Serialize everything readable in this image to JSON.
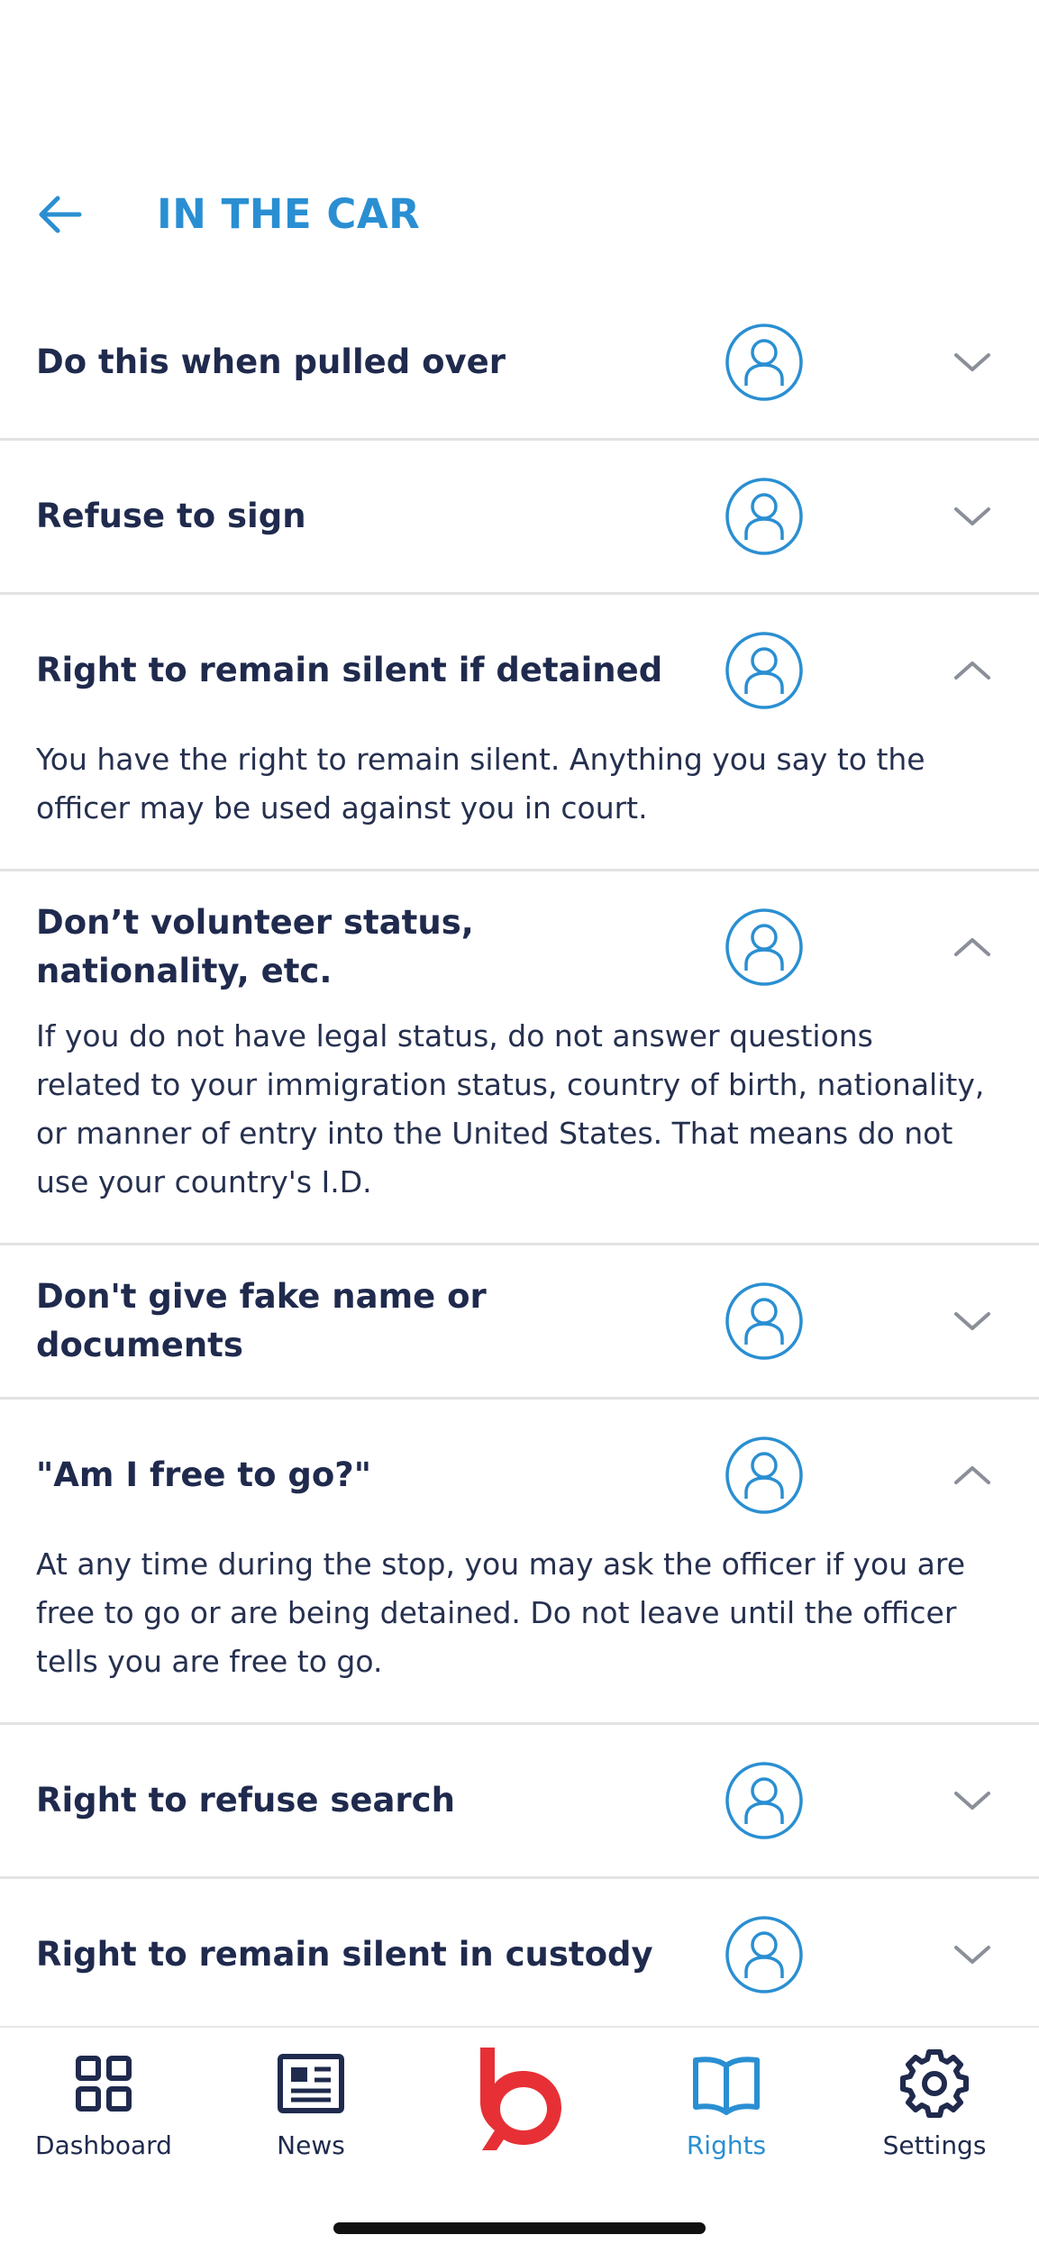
{
  "header": {
    "title": "IN THE CAR"
  },
  "items": [
    {
      "title": "Do this when pulled over",
      "expanded": false,
      "body": ""
    },
    {
      "title": "Refuse to sign",
      "expanded": false,
      "body": ""
    },
    {
      "title": "Right to remain silent if detained",
      "expanded": true,
      "body": "You have the right to remain silent. Anything you say to the officer may be used against you in court."
    },
    {
      "title": "Don’t volunteer status, nationality, etc.",
      "expanded": true,
      "body": "If you do not have legal status, do not answer questions related to your immigration status, country of birth, nationality, or manner of entry into the United States. That means do not use your country's I.D."
    },
    {
      "title": "Don't give fake name or documents",
      "expanded": false,
      "body": ""
    },
    {
      "title": "\"Am I free to go?\"",
      "expanded": true,
      "body": "At any time during the stop, you may ask the officer if you are free to go or are being detained. Do not leave until the officer tells you are free to go."
    },
    {
      "title": "Right to refuse search",
      "expanded": false,
      "body": ""
    },
    {
      "title": "Right to remain silent in custody",
      "expanded": false,
      "body": ""
    }
  ],
  "tabs": [
    {
      "label": "Dashboard",
      "icon": "grid-icon",
      "active": false
    },
    {
      "label": "News",
      "icon": "newspaper-icon",
      "active": false
    },
    {
      "label": "",
      "icon": "brand-logo-icon",
      "active": false
    },
    {
      "label": "Rights",
      "icon": "book-icon",
      "active": true
    },
    {
      "label": "Settings",
      "icon": "gear-icon",
      "active": false
    }
  ],
  "colors": {
    "accent": "#2a8fd2",
    "text": "#1f2a4d",
    "brand": "#e63035",
    "divider": "#e2e2e2",
    "chevron": "#8a8f99"
  }
}
